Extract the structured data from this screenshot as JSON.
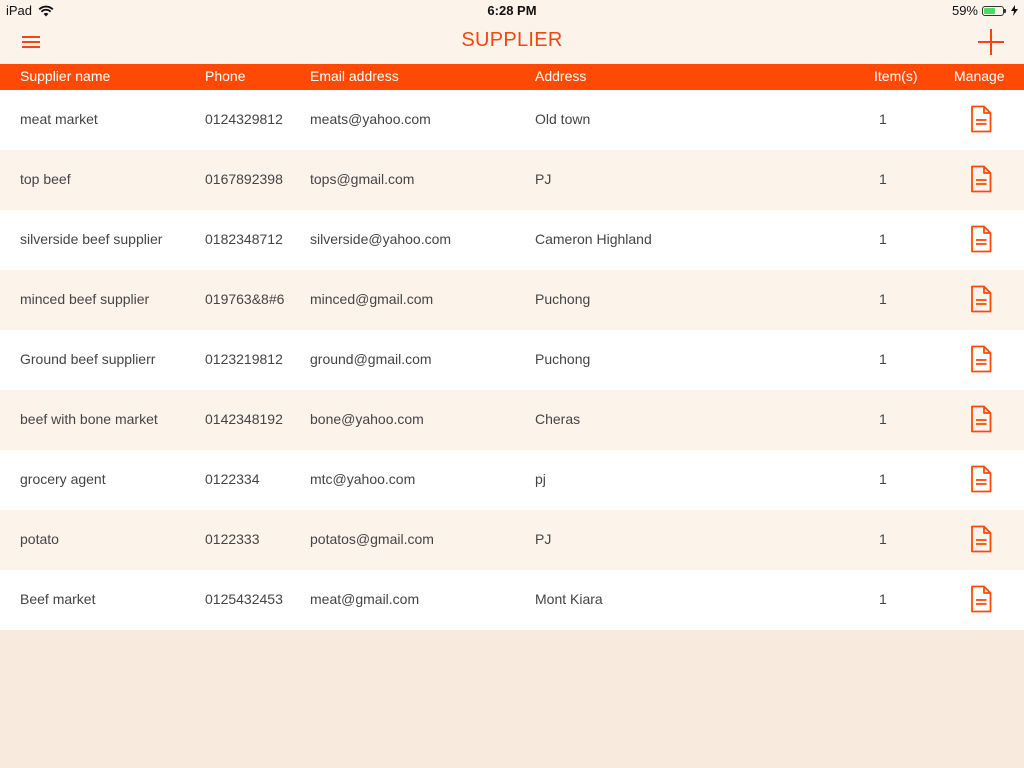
{
  "status_bar": {
    "device": "iPad",
    "time": "6:28 PM",
    "battery_percent": "59%",
    "battery_level": 0.59
  },
  "nav": {
    "title": "SUPPLIER"
  },
  "table": {
    "headers": {
      "name": "Supplier name",
      "phone": "Phone",
      "email": "Email address",
      "address": "Address",
      "items": "Item(s)",
      "manage": "Manage"
    },
    "rows": [
      {
        "name": "meat market",
        "phone": "0124329812",
        "email": "meats@yahoo.com",
        "address": "Old town",
        "items": "1"
      },
      {
        "name": "top beef",
        "phone": "0167892398",
        "email": "tops@gmail.com",
        "address": "PJ",
        "items": "1"
      },
      {
        "name": "silverside beef supplier",
        "phone": "0182348712",
        "email": "silverside@yahoo.com",
        "address": "Cameron Highland",
        "items": "1"
      },
      {
        "name": "minced beef supplier",
        "phone": "019763&8#6",
        "email": "minced@gmail.com",
        "address": "Puchong",
        "items": "1"
      },
      {
        "name": "Ground beef supplierr",
        "phone": "0123219812",
        "email": "ground@gmail.com",
        "address": "Puchong",
        "items": "1"
      },
      {
        "name": "beef with bone market",
        "phone": "0142348192",
        "email": "bone@yahoo.com",
        "address": "Cheras",
        "items": "1"
      },
      {
        "name": "grocery agent",
        "phone": "0122334",
        "email": "mtc@yahoo.com",
        "address": "pj",
        "items": "1"
      },
      {
        "name": "potato",
        "phone": "0122333",
        "email": "potatos@gmail.com",
        "address": "PJ",
        "items": "1"
      },
      {
        "name": "Beef market",
        "phone": "0125432453",
        "email": "meat@gmail.com",
        "address": "Mont Kiara",
        "items": "1"
      }
    ]
  },
  "icons": {
    "menu": "menu-icon",
    "add": "plus-icon",
    "manage": "document-icon",
    "wifi": "wifi-icon",
    "battery": "battery-icon",
    "charging": "charging-bolt-icon"
  },
  "colors": {
    "accent": "#ff4a05",
    "title": "#f2470f",
    "row_alt": "#fcf3eb",
    "background": "#f8eadd"
  }
}
